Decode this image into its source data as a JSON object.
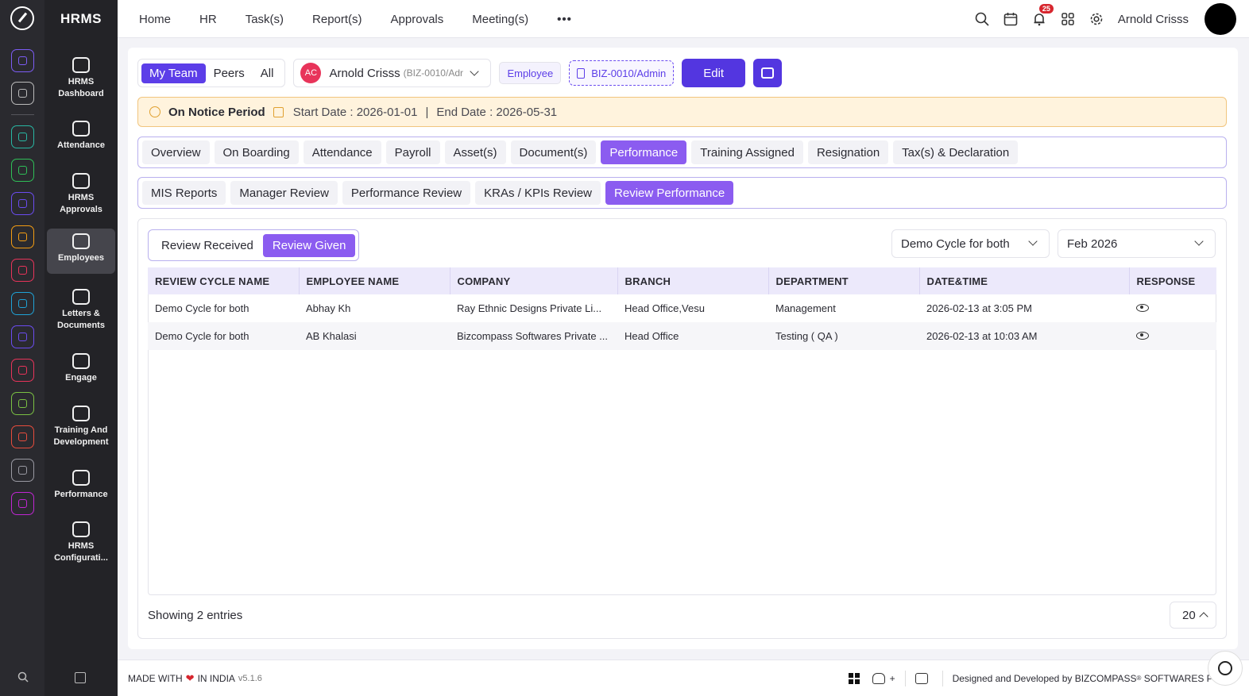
{
  "app": {
    "brand": "HRMS"
  },
  "rail": {
    "icons": [
      {
        "name": "home-icon",
        "color": "#7c5cf5"
      },
      {
        "name": "pin-icon",
        "color": "#bbbbbb"
      },
      {
        "name": "org-chart-icon",
        "color": "#28b7a3"
      },
      {
        "name": "module-green-icon",
        "color": "#2fbf57"
      },
      {
        "name": "module-violet-icon",
        "color": "#6b4cf0"
      },
      {
        "name": "module-orange-icon",
        "color": "#f39c12"
      },
      {
        "name": "target-icon",
        "color": "#e8345a"
      },
      {
        "name": "module-cyan-icon",
        "color": "#1fa2d6"
      },
      {
        "name": "module-indigo-icon",
        "color": "#6b4cf0"
      },
      {
        "name": "module-pink-icon",
        "color": "#e8345a"
      },
      {
        "name": "module-lime-icon",
        "color": "#7ac043"
      },
      {
        "name": "module-red-icon",
        "color": "#e74c3c"
      },
      {
        "name": "module-gray-icon",
        "color": "#9a9aa3"
      },
      {
        "name": "module-magenta-icon",
        "color": "#c026d3"
      }
    ]
  },
  "menu": {
    "items": [
      {
        "label": "HRMS Dashboard"
      },
      {
        "label": "Attendance"
      },
      {
        "label": "HRMS Approvals"
      },
      {
        "label": "Employees"
      },
      {
        "label": "Letters & Documents"
      },
      {
        "label": "Engage"
      },
      {
        "label": "Training And Development"
      },
      {
        "label": "Performance"
      },
      {
        "label": "HRMS Configurati..."
      }
    ]
  },
  "topnav": {
    "items": [
      "Home",
      "HR",
      "Task(s)",
      "Report(s)",
      "Approvals",
      "Meeting(s)"
    ],
    "more": "•••",
    "notification_count": "25",
    "username": "Arnold Crisss"
  },
  "header": {
    "scope_tabs": [
      "My Team",
      "Peers",
      "All"
    ],
    "employee": {
      "initials": "AC",
      "name": "Arnold Crisss",
      "id": "(BIZ-0010/Adr"
    },
    "role_tag": "Employee",
    "id_tag": "BIZ-0010/Admin",
    "edit_label": "Edit"
  },
  "notice": {
    "title": "On Notice Period",
    "start": "Start Date : 2026-01-01",
    "separator": "|",
    "end": "End Date : 2026-05-31"
  },
  "main_tabs": [
    "Overview",
    "On Boarding",
    "Attendance",
    "Payroll",
    "Asset(s)",
    "Document(s)",
    "Performance",
    "Training Assigned",
    "Resignation",
    "Tax(s) & Declaration"
  ],
  "sub_tabs": [
    "MIS Reports",
    "Manager Review",
    "Performance Review",
    "KRAs / KPIs Review",
    "Review Performance"
  ],
  "review": {
    "toggle": [
      "Review Received",
      "Review Given"
    ],
    "cycle_select": "Demo Cycle for both",
    "month_select": "Feb 2026",
    "columns": [
      "REVIEW CYCLE NAME",
      "EMPLOYEE NAME",
      "COMPANY",
      "BRANCH",
      "DEPARTMENT",
      "DATE&TIME",
      "RESPONSE"
    ],
    "rows": [
      {
        "cycle": "Demo Cycle for both",
        "employee": "Abhay Kh",
        "company": "Ray Ethnic Designs Private Li...",
        "branch": "Head Office,Vesu",
        "department": "Management",
        "datetime": "2026-02-13 at 3:05 PM"
      },
      {
        "cycle": "Demo Cycle for both",
        "employee": "AB Khalasi",
        "company": "Bizcompass Softwares Private ...",
        "branch": "Head Office",
        "department": "Testing ( QA )",
        "datetime": "2026-02-13 at 10:03 AM"
      }
    ],
    "showing": "Showing 2 entries",
    "page_size": "20"
  },
  "footer": {
    "made_with": "MADE WITH",
    "in_india": "IN INDIA",
    "version": "v5.1.6",
    "designed_by": "Designed and Developed by",
    "company": "BIZCOMPASS",
    "reg": "®",
    "company_suffix": "SOFTWARES PVT"
  }
}
